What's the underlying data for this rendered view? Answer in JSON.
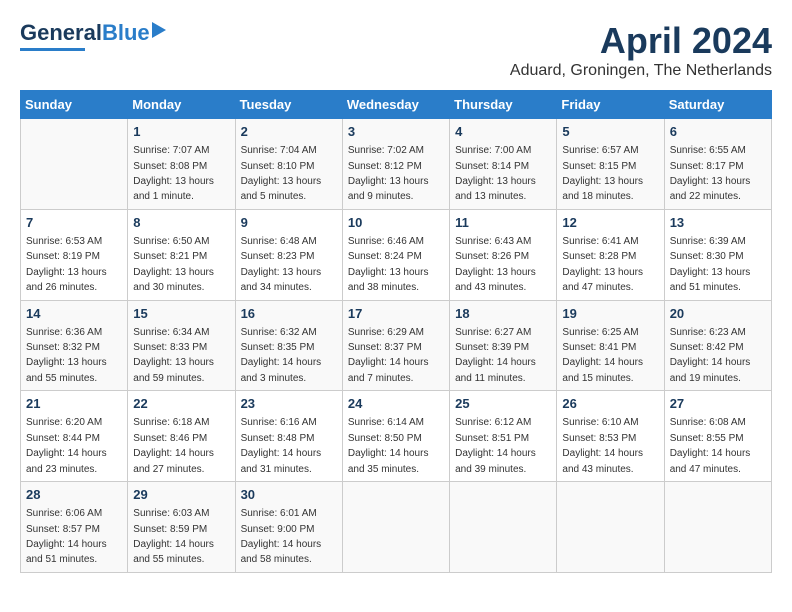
{
  "header": {
    "logo_general": "General",
    "logo_blue": "Blue",
    "month_title": "April 2024",
    "subtitle": "Aduard, Groningen, The Netherlands"
  },
  "days_of_week": [
    "Sunday",
    "Monday",
    "Tuesday",
    "Wednesday",
    "Thursday",
    "Friday",
    "Saturday"
  ],
  "weeks": [
    [
      {
        "day": "",
        "sunrise": "",
        "sunset": "",
        "daylight": ""
      },
      {
        "day": "1",
        "sunrise": "Sunrise: 7:07 AM",
        "sunset": "Sunset: 8:08 PM",
        "daylight": "Daylight: 13 hours and 1 minute."
      },
      {
        "day": "2",
        "sunrise": "Sunrise: 7:04 AM",
        "sunset": "Sunset: 8:10 PM",
        "daylight": "Daylight: 13 hours and 5 minutes."
      },
      {
        "day": "3",
        "sunrise": "Sunrise: 7:02 AM",
        "sunset": "Sunset: 8:12 PM",
        "daylight": "Daylight: 13 hours and 9 minutes."
      },
      {
        "day": "4",
        "sunrise": "Sunrise: 7:00 AM",
        "sunset": "Sunset: 8:14 PM",
        "daylight": "Daylight: 13 hours and 13 minutes."
      },
      {
        "day": "5",
        "sunrise": "Sunrise: 6:57 AM",
        "sunset": "Sunset: 8:15 PM",
        "daylight": "Daylight: 13 hours and 18 minutes."
      },
      {
        "day": "6",
        "sunrise": "Sunrise: 6:55 AM",
        "sunset": "Sunset: 8:17 PM",
        "daylight": "Daylight: 13 hours and 22 minutes."
      }
    ],
    [
      {
        "day": "7",
        "sunrise": "Sunrise: 6:53 AM",
        "sunset": "Sunset: 8:19 PM",
        "daylight": "Daylight: 13 hours and 26 minutes."
      },
      {
        "day": "8",
        "sunrise": "Sunrise: 6:50 AM",
        "sunset": "Sunset: 8:21 PM",
        "daylight": "Daylight: 13 hours and 30 minutes."
      },
      {
        "day": "9",
        "sunrise": "Sunrise: 6:48 AM",
        "sunset": "Sunset: 8:23 PM",
        "daylight": "Daylight: 13 hours and 34 minutes."
      },
      {
        "day": "10",
        "sunrise": "Sunrise: 6:46 AM",
        "sunset": "Sunset: 8:24 PM",
        "daylight": "Daylight: 13 hours and 38 minutes."
      },
      {
        "day": "11",
        "sunrise": "Sunrise: 6:43 AM",
        "sunset": "Sunset: 8:26 PM",
        "daylight": "Daylight: 13 hours and 43 minutes."
      },
      {
        "day": "12",
        "sunrise": "Sunrise: 6:41 AM",
        "sunset": "Sunset: 8:28 PM",
        "daylight": "Daylight: 13 hours and 47 minutes."
      },
      {
        "day": "13",
        "sunrise": "Sunrise: 6:39 AM",
        "sunset": "Sunset: 8:30 PM",
        "daylight": "Daylight: 13 hours and 51 minutes."
      }
    ],
    [
      {
        "day": "14",
        "sunrise": "Sunrise: 6:36 AM",
        "sunset": "Sunset: 8:32 PM",
        "daylight": "Daylight: 13 hours and 55 minutes."
      },
      {
        "day": "15",
        "sunrise": "Sunrise: 6:34 AM",
        "sunset": "Sunset: 8:33 PM",
        "daylight": "Daylight: 13 hours and 59 minutes."
      },
      {
        "day": "16",
        "sunrise": "Sunrise: 6:32 AM",
        "sunset": "Sunset: 8:35 PM",
        "daylight": "Daylight: 14 hours and 3 minutes."
      },
      {
        "day": "17",
        "sunrise": "Sunrise: 6:29 AM",
        "sunset": "Sunset: 8:37 PM",
        "daylight": "Daylight: 14 hours and 7 minutes."
      },
      {
        "day": "18",
        "sunrise": "Sunrise: 6:27 AM",
        "sunset": "Sunset: 8:39 PM",
        "daylight": "Daylight: 14 hours and 11 minutes."
      },
      {
        "day": "19",
        "sunrise": "Sunrise: 6:25 AM",
        "sunset": "Sunset: 8:41 PM",
        "daylight": "Daylight: 14 hours and 15 minutes."
      },
      {
        "day": "20",
        "sunrise": "Sunrise: 6:23 AM",
        "sunset": "Sunset: 8:42 PM",
        "daylight": "Daylight: 14 hours and 19 minutes."
      }
    ],
    [
      {
        "day": "21",
        "sunrise": "Sunrise: 6:20 AM",
        "sunset": "Sunset: 8:44 PM",
        "daylight": "Daylight: 14 hours and 23 minutes."
      },
      {
        "day": "22",
        "sunrise": "Sunrise: 6:18 AM",
        "sunset": "Sunset: 8:46 PM",
        "daylight": "Daylight: 14 hours and 27 minutes."
      },
      {
        "day": "23",
        "sunrise": "Sunrise: 6:16 AM",
        "sunset": "Sunset: 8:48 PM",
        "daylight": "Daylight: 14 hours and 31 minutes."
      },
      {
        "day": "24",
        "sunrise": "Sunrise: 6:14 AM",
        "sunset": "Sunset: 8:50 PM",
        "daylight": "Daylight: 14 hours and 35 minutes."
      },
      {
        "day": "25",
        "sunrise": "Sunrise: 6:12 AM",
        "sunset": "Sunset: 8:51 PM",
        "daylight": "Daylight: 14 hours and 39 minutes."
      },
      {
        "day": "26",
        "sunrise": "Sunrise: 6:10 AM",
        "sunset": "Sunset: 8:53 PM",
        "daylight": "Daylight: 14 hours and 43 minutes."
      },
      {
        "day": "27",
        "sunrise": "Sunrise: 6:08 AM",
        "sunset": "Sunset: 8:55 PM",
        "daylight": "Daylight: 14 hours and 47 minutes."
      }
    ],
    [
      {
        "day": "28",
        "sunrise": "Sunrise: 6:06 AM",
        "sunset": "Sunset: 8:57 PM",
        "daylight": "Daylight: 14 hours and 51 minutes."
      },
      {
        "day": "29",
        "sunrise": "Sunrise: 6:03 AM",
        "sunset": "Sunset: 8:59 PM",
        "daylight": "Daylight: 14 hours and 55 minutes."
      },
      {
        "day": "30",
        "sunrise": "Sunrise: 6:01 AM",
        "sunset": "Sunset: 9:00 PM",
        "daylight": "Daylight: 14 hours and 58 minutes."
      },
      {
        "day": "",
        "sunrise": "",
        "sunset": "",
        "daylight": ""
      },
      {
        "day": "",
        "sunrise": "",
        "sunset": "",
        "daylight": ""
      },
      {
        "day": "",
        "sunrise": "",
        "sunset": "",
        "daylight": ""
      },
      {
        "day": "",
        "sunrise": "",
        "sunset": "",
        "daylight": ""
      }
    ]
  ]
}
